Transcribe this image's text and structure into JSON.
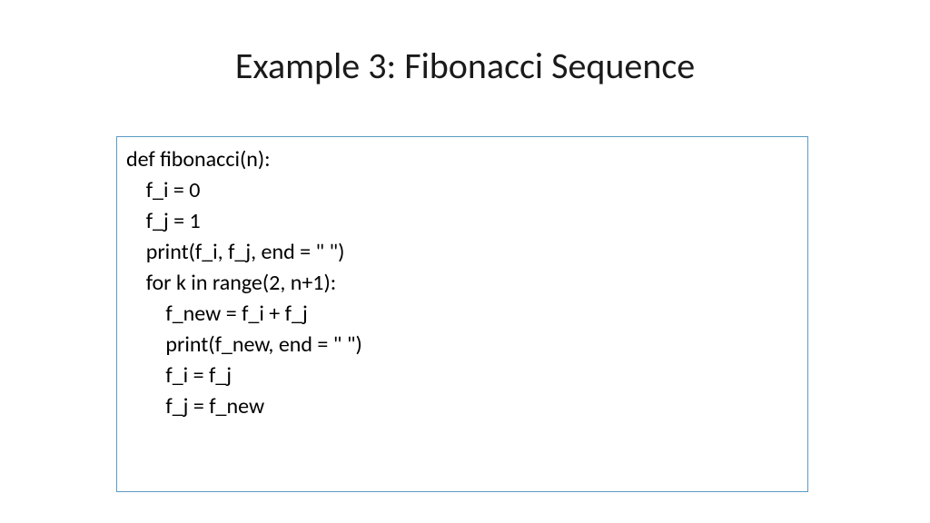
{
  "title": "Example 3: Fibonacci Sequence",
  "code": {
    "l0": "def fibonacci(n):",
    "l1": "    f_i = 0",
    "l2": "    f_j = 1",
    "l3": "",
    "l4": "    print(f_i, f_j, end = \" \")",
    "l5": "",
    "l6": "    for k in range(2, n+1):",
    "l7": "        f_new = f_i + f_j",
    "l8": "        print(f_new, end = \" \")",
    "l9": "        f_i = f_j",
    "l10": "        f_j = f_new"
  }
}
